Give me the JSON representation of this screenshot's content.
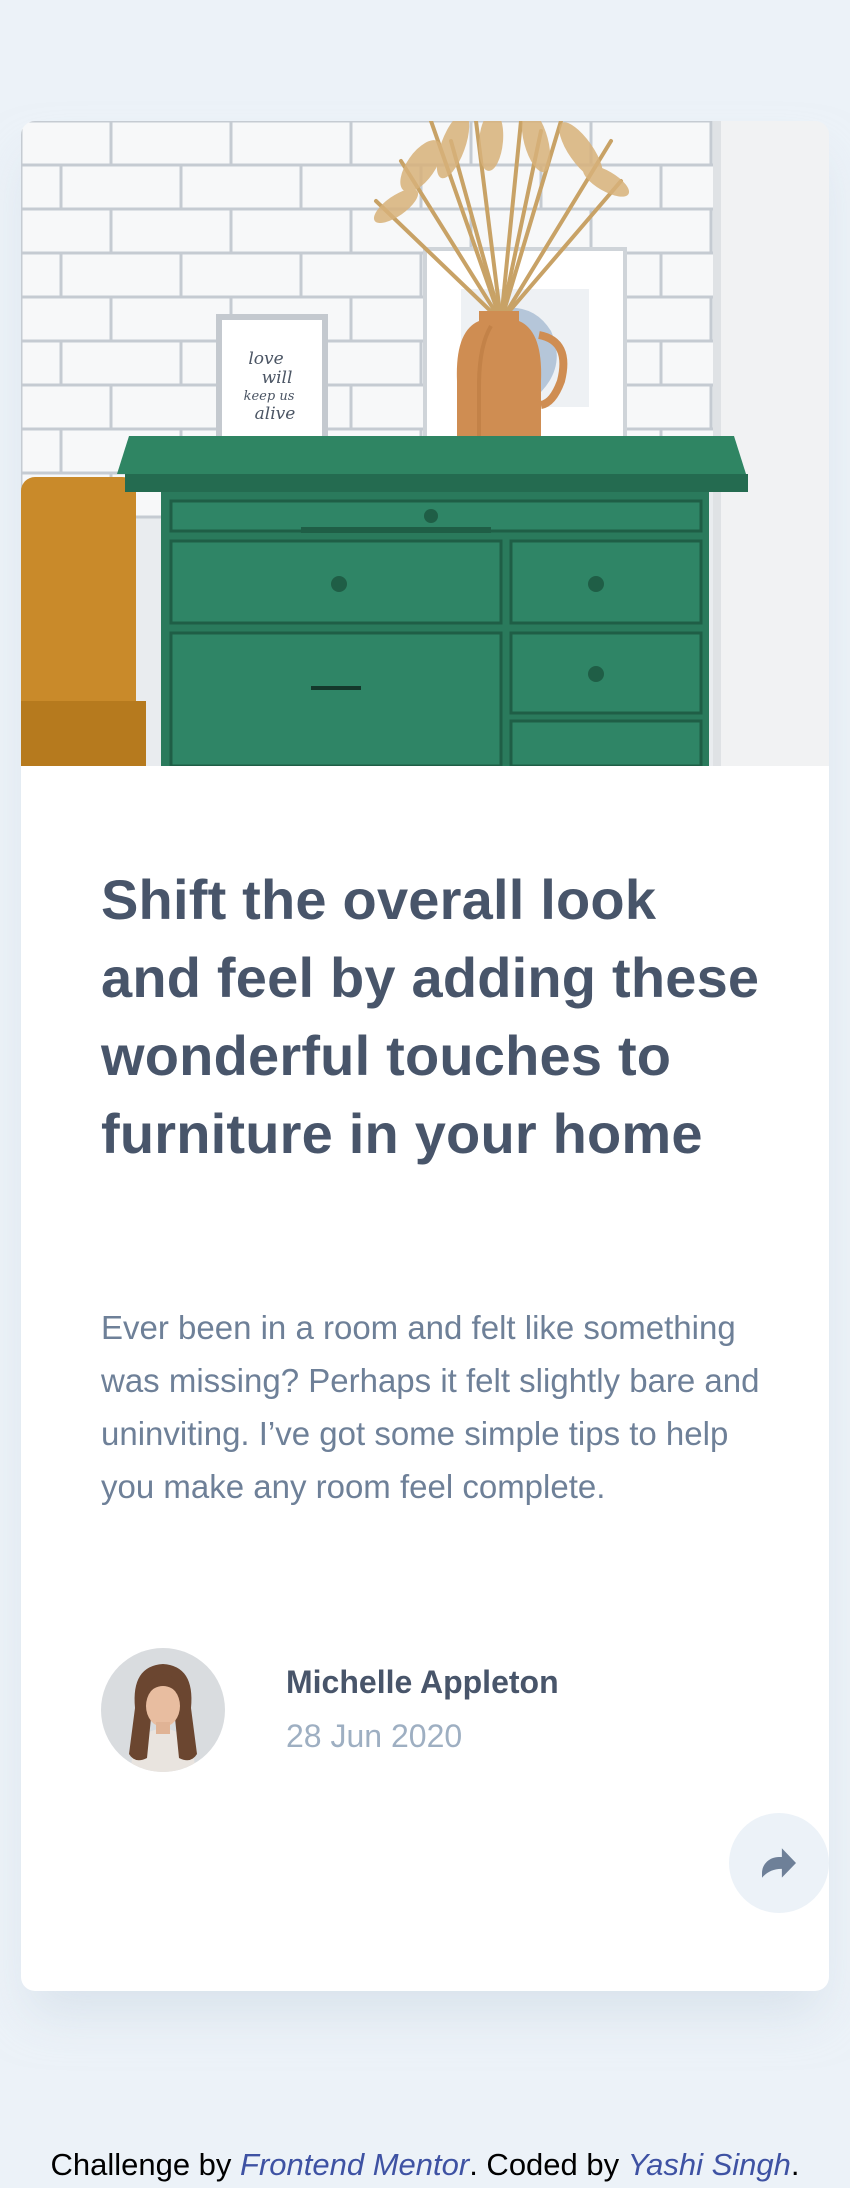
{
  "article": {
    "image_alt": "Green drawer with vase, picture frames on a white brick wall",
    "frame_text": [
      "love",
      "will",
      "keep us",
      "alive"
    ],
    "title": "Shift the overall look and feel by adding these wonderful touches to furniture in your home",
    "description": "Ever been in a room and felt like something was missing? Perhaps it felt slightly bare and uninviting. I’ve got some simple tips to help you make any room feel complete.",
    "author": {
      "name": "Michelle Appleton",
      "date": "28 Jun 2020",
      "avatar_icon": "avatar-photo"
    },
    "share_icon": "share-icon"
  },
  "footer": {
    "prefix": "Challenge by ",
    "link1": "Frontend Mentor",
    "middle": ". Coded by ",
    "link2": "Yashi Singh",
    "suffix": "."
  },
  "colors": {
    "background": "#ecf2f8",
    "card": "#ffffff",
    "title": "#48556a",
    "text": "#6e8098",
    "muted": "#9eafc2",
    "drawer": "#2c7a60",
    "link": "#3e52a3"
  }
}
